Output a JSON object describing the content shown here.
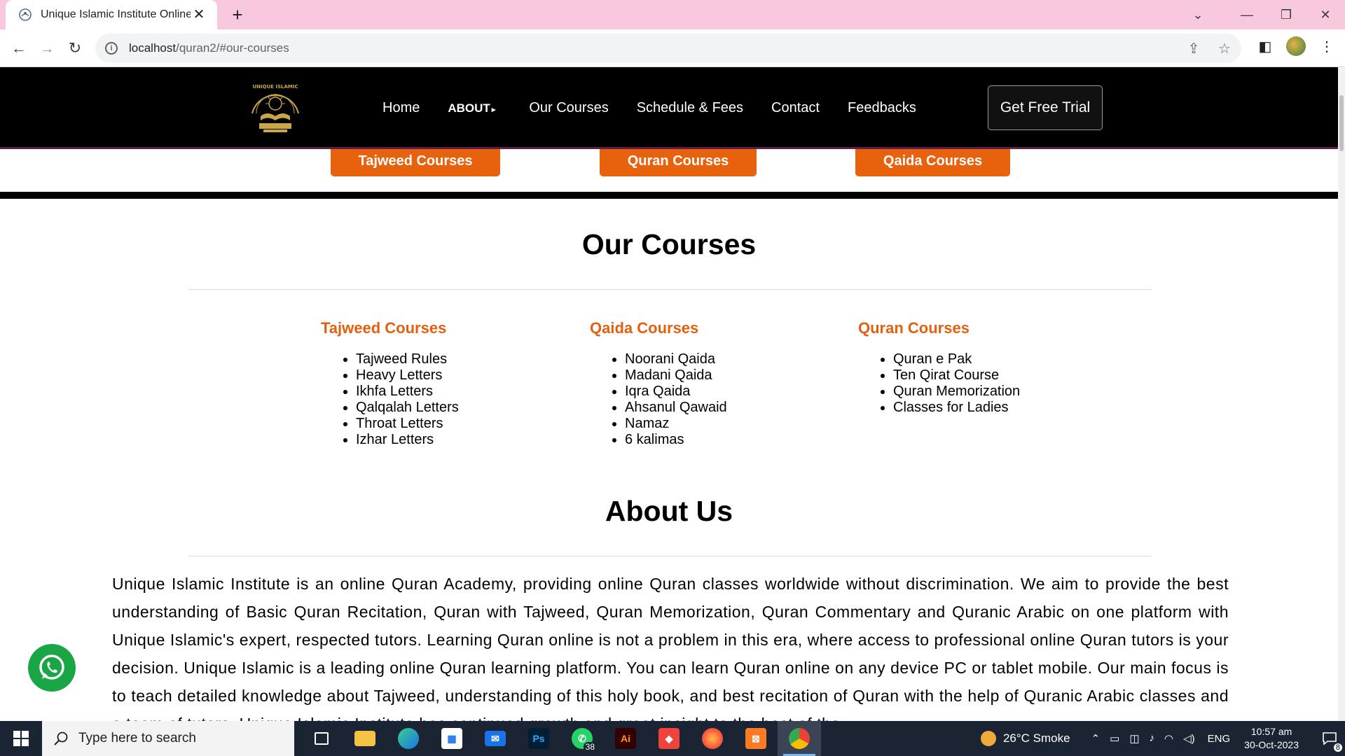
{
  "browser": {
    "tab_title": "Unique Islamic Institute Online",
    "url_host": "localhost",
    "url_path": "/quran2/#our-courses"
  },
  "site": {
    "logo_text": "UNIQUE ISLAMIC INSTITUTE",
    "nav": {
      "home": "Home",
      "about": "About",
      "courses": "Our Courses",
      "schedule": "Schedule & Fees",
      "contact": "Contact",
      "feedbacks": "Feedbacks"
    },
    "cta": "Get Free Trial"
  },
  "hero_buttons": {
    "tajweed": "Tajweed Courses",
    "quran": "Quran Courses",
    "qaida": "Qaida Courses"
  },
  "courses_section": {
    "title": "Our Courses",
    "columns": [
      {
        "heading": "Tajweed Courses",
        "items": [
          "Tajweed Rules",
          "Heavy Letters",
          "Ikhfa Letters",
          "Qalqalah Letters",
          "Throat Letters",
          "Izhar Letters"
        ]
      },
      {
        "heading": "Qaida Courses",
        "items": [
          "Noorani Qaida",
          "Madani Qaida",
          "Iqra Qaida",
          "Ahsanul Qawaid",
          "Namaz",
          "6 kalimas"
        ]
      },
      {
        "heading": "Quran Courses",
        "items": [
          "Quran e Pak",
          "Ten Qirat Course",
          "Quran Memorization",
          "Classes for Ladies"
        ]
      }
    ]
  },
  "about_section": {
    "title": "About Us",
    "body": "Unique Islamic Institute is an online Quran Academy, providing online Quran classes worldwide without discrimination. We aim to provide the best understanding of Basic Quran Recitation, Quran with Tajweed, Quran Memorization, Quran Commentary and Quranic Arabic on one platform with Unique Islamic's expert, respected tutors. Learning Quran online is not a problem in this era, where access to professional online Quran tutors is your decision. Unique Islamic is a leading online Quran learning platform. You can learn Quran online on any device PC or tablet mobile. Our main focus is to teach detailed knowledge about Tajweed, understanding of this holy book, and best recitation of Quran with the help of Quranic Arabic classes and a team of tutors. Unique Islamic Institute has continued growth and great insight to the best of the"
  },
  "taskbar": {
    "search_placeholder": "Type here to search",
    "whatsapp_badge": "38",
    "weather": "26°C  Smoke",
    "lang": "ENG",
    "time": "10:57 am",
    "date": "30-Oct-2023",
    "notif_count": "8"
  },
  "colors": {
    "accent_orange": "#e8610c",
    "header_bg": "#000000",
    "tab_strip": "#f8c8dc",
    "whatsapp_green": "#1aa546"
  }
}
